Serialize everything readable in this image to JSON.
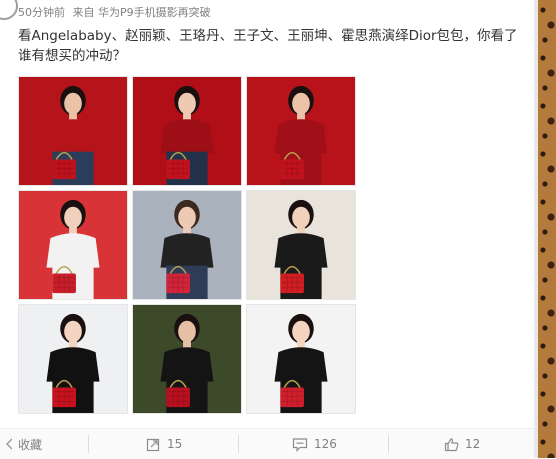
{
  "post": {
    "meta": {
      "time": "50分钟前",
      "source": "来自 华为P9手机摄影再突破"
    },
    "text": "看Angelababy、赵丽颖、王珞丹、王子文、王丽坤、霍思燕演绎Dior包包，你看了谁有想买的冲动？",
    "images": [
      {
        "bg": "#b5141b",
        "top": "#b5141b",
        "bottom": "#2a3e5c",
        "bag": "#c0121c",
        "skin": "#e9c2a8",
        "hair": "#1a1010"
      },
      {
        "bg": "#b10f17",
        "top": "#9e0e16",
        "bottom": "#22324a",
        "bag": "#c2121d",
        "skin": "#efc9b0",
        "hair": "#1a1010"
      },
      {
        "bg": "#b8131b",
        "top": "#a10f18",
        "bottom": "#a10f18",
        "bag": "#c2121d",
        "skin": "#ecc3a8",
        "hair": "#1a1010"
      },
      {
        "bg": "#d83438",
        "top": "#f2f2f2",
        "bottom": "#f2f2f2",
        "bag": "#c81e2a",
        "skin": "#f0d0bc",
        "hair": "#1a1010"
      },
      {
        "bg": "#a9b2bd",
        "top": "#222222",
        "bottom": "#2e3c58",
        "bag": "#d2243a",
        "skin": "#eccab4",
        "hair": "#3a2a20"
      },
      {
        "bg": "#e8e4dc",
        "top": "#1a1a1a",
        "bottom": "#1a1a1a",
        "bag": "#d01e22",
        "skin": "#f0d2bc",
        "hair": "#1a1010"
      },
      {
        "bg": "#eef0f2",
        "top": "#111111",
        "bottom": "#111111",
        "bag": "#c8121e",
        "skin": "#f2d4c0",
        "hair": "#1a1010"
      },
      {
        "bg": "#3c4a2a",
        "top": "#141414",
        "bottom": "#141414",
        "bag": "#b81020",
        "skin": "#e6c0a4",
        "hair": "#1a1010"
      },
      {
        "bg": "#f3f3f3",
        "top": "#141414",
        "bottom": "#141414",
        "bag": "#d01e2c",
        "skin": "#f2d4c0",
        "hair": "#1a1010"
      }
    ],
    "actions": {
      "favorite": "收藏",
      "repost_count": "15",
      "comment_count": "126",
      "like_count": "12"
    }
  }
}
